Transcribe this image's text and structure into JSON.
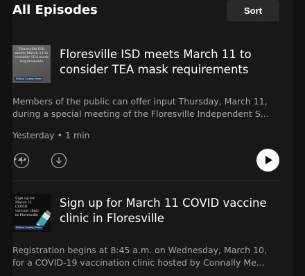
{
  "header": {
    "title": "All Episodes",
    "sort_label": "Sort"
  },
  "episodes": [
    {
      "title": "Floresville ISD meets March 11 to consider TEA mask requirements",
      "thumbnail_text": "Floresville ISD meets March 11 to consider TEA mask requirements",
      "thumbnail_logo": "Wilson County News",
      "description_line1": "Members of the public can offer input Thursday, March 11,",
      "description_line2": "during a special meeting of the Floresville Independent S...",
      "meta": "Yesterday • 1 min"
    },
    {
      "title": "Sign up for March 11 COVID vaccine clinic in Floresville",
      "thumbnail_text": "Sign up for March 11 COVID vaccine clinic in Floresville",
      "thumbnail_logo": "Wilson County News",
      "description_line1": "Registration begins at 8:45 a.m. on Wednesday, March 10,",
      "description_line2": "for a COVID-19 vaccination clinic hosted by Connally Me..."
    }
  ],
  "colors": {
    "background": "#121212",
    "panel": "#181818",
    "text_primary": "#ffffff",
    "text_secondary": "#a7a7a7",
    "button_bg": "#2a2a2a"
  },
  "icons": {
    "add": "plus-circle-icon",
    "download": "download-circle-icon",
    "more": "more-dots-icon",
    "play": "play-icon"
  }
}
